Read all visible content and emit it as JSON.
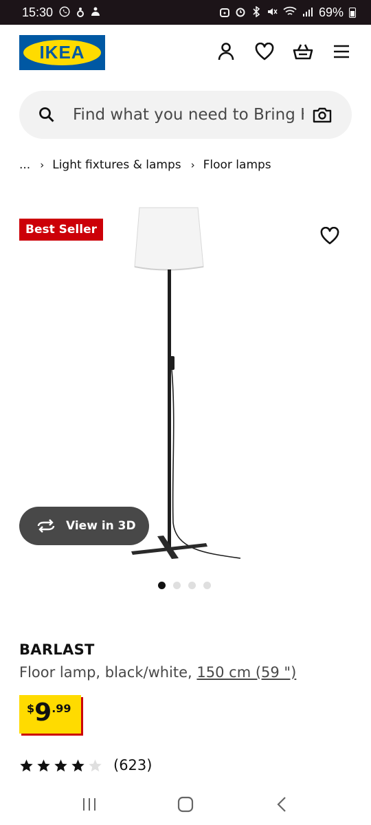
{
  "status_bar": {
    "time": "15:30",
    "battery": "69%"
  },
  "header": {
    "logo_text": "IKEA"
  },
  "search": {
    "placeholder": "Find what you need to Bring Hc"
  },
  "breadcrumb": {
    "ellipsis": "...",
    "items": [
      "Light fixtures & lamps",
      "Floor lamps"
    ]
  },
  "gallery": {
    "badge": "Best Seller",
    "view_3d_label": "View in 3D",
    "image_count": 4,
    "active_image": 0
  },
  "product": {
    "name": "BARLAST",
    "description": "Floor lamp, black/white, ",
    "size_link": "150 cm (59 \")",
    "price_currency": "$",
    "price_integer": "9",
    "price_decimal": ".99",
    "rating_stars": 4,
    "rating_count": "(623)"
  },
  "colors": {
    "ikea_blue": "#0058a3",
    "ikea_yellow": "#ffdb00",
    "badge_red": "#cc0008"
  }
}
